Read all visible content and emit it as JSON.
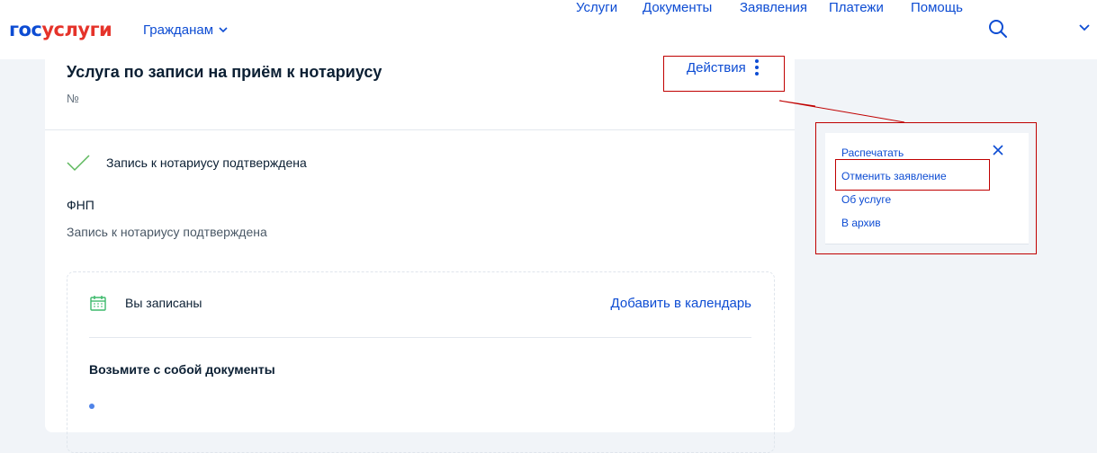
{
  "header": {
    "logo_part1": "гос",
    "logo_part2": "услуги",
    "audience": "Гражданам",
    "nav": [
      "Услуги",
      "Документы",
      "Заявления",
      "Платежи",
      "Помощь"
    ]
  },
  "service": {
    "title": "Услуга по записи на приём к нотариусу",
    "number_label": "№",
    "actions_label": "Действия",
    "status": "Запись к нотариусу подтверждена",
    "org": "ФНП",
    "org_status": "Запись к нотариусу подтверждена",
    "appointment_label": "Вы записаны",
    "add_calendar": "Добавить в календарь",
    "docs_title": "Возьмите с собой документы"
  },
  "dropdown": {
    "items": [
      "Распечатать",
      "Отменить заявление",
      "Об услуге",
      "В архив"
    ]
  },
  "colors": {
    "brand_blue": "#0d4cd3",
    "brand_red": "#e5332a",
    "success_green": "#5cb85c",
    "highlight_red": "#c00000"
  }
}
